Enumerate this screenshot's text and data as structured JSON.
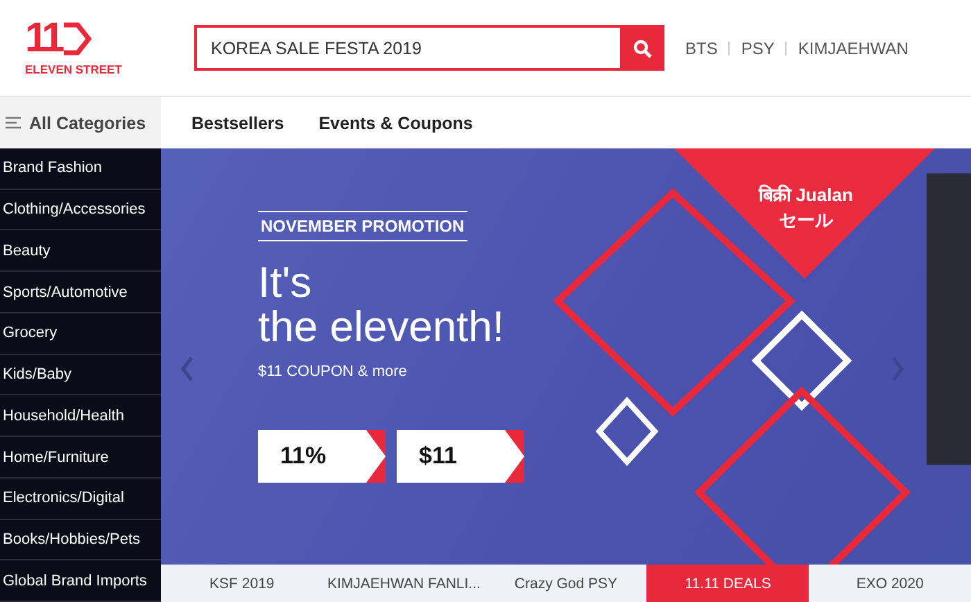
{
  "logo": {
    "mark": "11",
    "name": "ELEVEN STREET"
  },
  "search": {
    "value": "KOREA SALE FESTA 2019"
  },
  "hot_keywords": [
    "BTS",
    "PSY",
    "KIMJAEHWAN"
  ],
  "all_categories": "All Categories",
  "nav_links": [
    "Bestsellers",
    "Events & Coupons"
  ],
  "categories": [
    "Brand Fashion",
    "Clothing/Accessories",
    "Beauty",
    "Sports/Automotive",
    "Grocery",
    "Kids/Baby",
    "Household/Health",
    "Home/Furniture",
    "Electronics/Digital",
    "Books/Hobbies/Pets",
    "Global Brand Imports"
  ],
  "banner": {
    "badge": "NOVEMBER PROMOTION",
    "headline": [
      "It's",
      "the eleventh!"
    ],
    "subline": "$11 COUPON & more",
    "coupons": [
      "11%",
      "$11"
    ],
    "corner_text": [
      "बिक्री Jualan",
      "セール"
    ]
  },
  "bottom_tabs": [
    {
      "label": "KSF 2019",
      "selected": false
    },
    {
      "label": "KIMJAEHWAN FANLI...",
      "selected": false
    },
    {
      "label": "Crazy God PSY",
      "selected": false
    },
    {
      "label": "11.11 DEALS",
      "selected": true
    },
    {
      "label": "EXO 2020",
      "selected": false
    }
  ]
}
